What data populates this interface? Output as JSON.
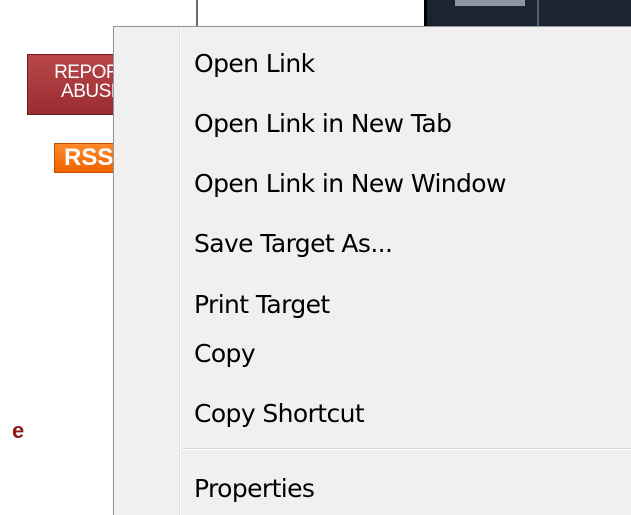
{
  "background": {
    "report_abuse": {
      "line1": "REPORT",
      "line2": "ABUSE"
    },
    "rss_label": "RSS",
    "page_text_fragment": "e"
  },
  "context_menu": {
    "items": [
      {
        "label": "Open Link"
      },
      {
        "label": "Open Link in New Tab"
      },
      {
        "label": "Open Link in New Window"
      },
      {
        "label": "Save Target As..."
      },
      {
        "label": "Print Target"
      },
      {
        "label": "Copy"
      },
      {
        "label": "Copy Shortcut"
      },
      {
        "label": "Properties"
      }
    ]
  },
  "colors": {
    "menu_background": "#f0f0f0",
    "menu_border": "#979797",
    "report_button": "#a8383c",
    "rss_button": "#f27113"
  }
}
